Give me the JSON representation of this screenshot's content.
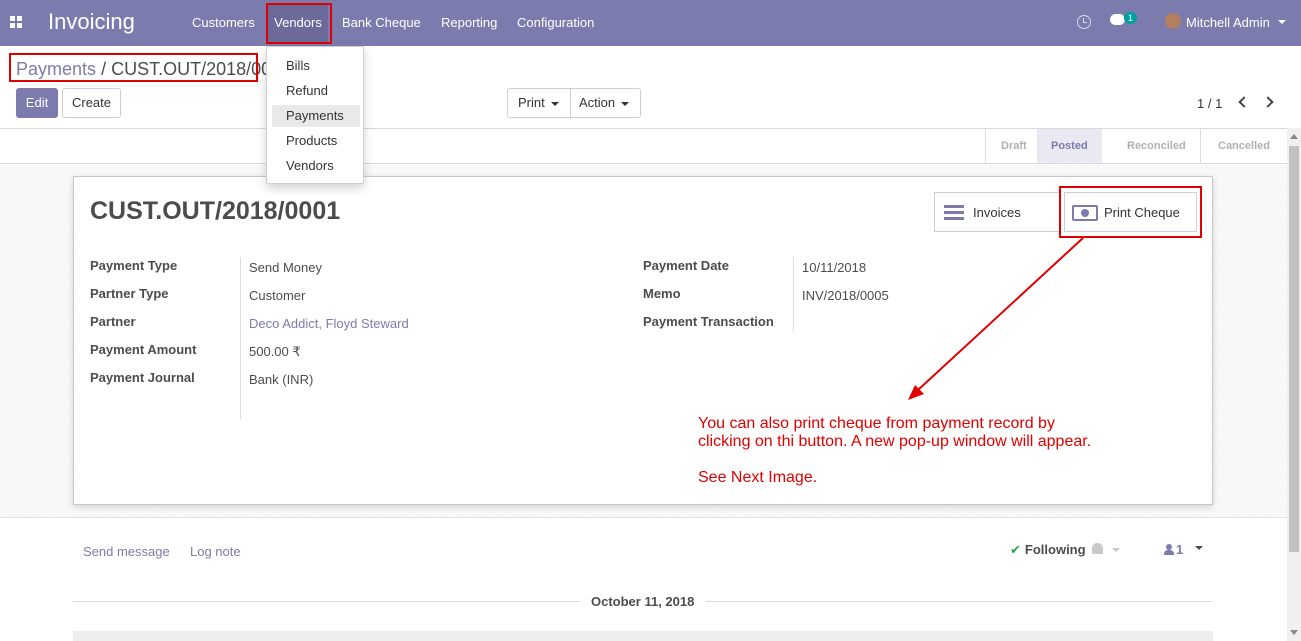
{
  "navbar": {
    "app_title": "Invoicing",
    "menu": [
      "Customers",
      "Vendors",
      "Bank Cheque",
      "Reporting",
      "Configuration"
    ],
    "chat_count": "1",
    "user_name": "Mitchell Admin"
  },
  "vendors_menu": [
    "Bills",
    "Refund",
    "Payments",
    "Products",
    "Vendors"
  ],
  "breadcrumb": {
    "parent": "Payments",
    "separator": "/",
    "current": "CUST.OUT/2018/0001"
  },
  "buttons": {
    "edit": "Edit",
    "create": "Create",
    "print": "Print",
    "action": "Action"
  },
  "pager": "1 / 1",
  "statusbar": [
    "Draft",
    "Posted",
    "Reconciled",
    "Cancelled"
  ],
  "status_active": "Posted",
  "record": {
    "title": "CUST.OUT/2018/0001",
    "smart_buttons": {
      "invoices": "Invoices",
      "print_cheque": "Print Cheque"
    },
    "left_fields": [
      {
        "label": "Payment Type",
        "value": "Send Money"
      },
      {
        "label": "Partner Type",
        "value": "Customer"
      },
      {
        "label": "Partner",
        "value": "Deco Addict, Floyd Steward"
      },
      {
        "label": "Payment Amount",
        "value": "500.00 ₹"
      },
      {
        "label": "Payment Journal",
        "value": "Bank (INR)"
      }
    ],
    "right_fields": [
      {
        "label": "Payment Date",
        "value": "10/11/2018"
      },
      {
        "label": "Memo",
        "value": "INV/2018/0005"
      },
      {
        "label": "Payment Transaction",
        "value": ""
      }
    ]
  },
  "annotation": {
    "line1": "You can also print cheque from payment record by",
    "line2": "clicking on thi button. A new pop-up window will appear.",
    "line3": "See Next Image.",
    "color": "#e00000"
  },
  "chatter": {
    "send_message": "Send message",
    "log_note": "Log note",
    "following": "Following",
    "followers": "1",
    "date_separator": "October 11, 2018"
  },
  "colors": {
    "brand": "#7c7bad",
    "annotation": "#e00000"
  }
}
